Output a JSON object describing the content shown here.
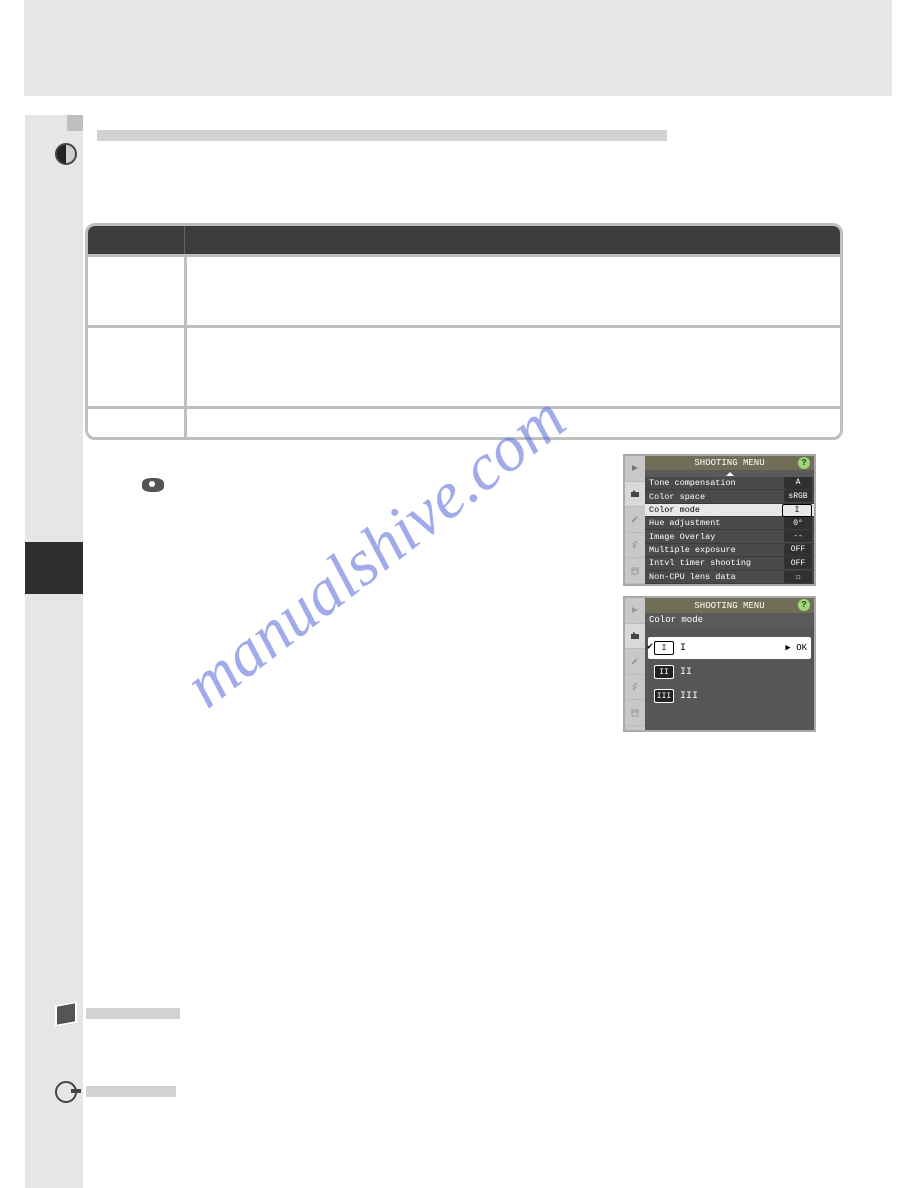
{
  "watermark": "manualshive.com",
  "screenshots": {
    "shooting_menu": {
      "title": "SHOOTING MENU",
      "help": "?",
      "items": [
        {
          "label": "Tone compensation",
          "value": "A"
        },
        {
          "label": "Color space",
          "value": "sRGB"
        },
        {
          "label": "Color mode",
          "value": "I",
          "selected": true
        },
        {
          "label": "Hue adjustment",
          "value": "0°"
        },
        {
          "label": "Image Overlay",
          "value": "--"
        },
        {
          "label": "Multiple exposure",
          "value": "OFF"
        },
        {
          "label": "Intvl timer shooting",
          "value": "OFF"
        },
        {
          "label": "Non-CPU lens data",
          "value": "☐"
        }
      ]
    },
    "color_mode_menu": {
      "title": "SHOOTING MENU",
      "subtitle": "Color mode",
      "help": "?",
      "options": [
        {
          "glyph": "I",
          "label": "I",
          "selected": true,
          "checked": true,
          "ok": "▶ OK"
        },
        {
          "glyph": "II",
          "label": "II"
        },
        {
          "glyph": "III",
          "label": "III"
        }
      ]
    }
  }
}
